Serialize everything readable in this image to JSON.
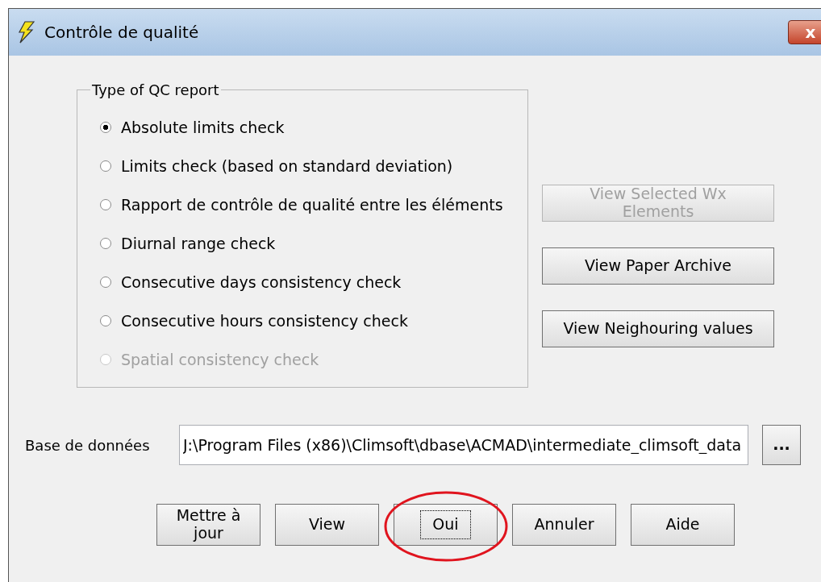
{
  "window": {
    "title": "Contrôle de qualité",
    "close": "x"
  },
  "report_type": {
    "legend": "Type of QC report",
    "options": [
      {
        "label": "Absolute limits check",
        "selected": true,
        "disabled": false
      },
      {
        "label": "Limits check (based on standard deviation)",
        "selected": false,
        "disabled": false
      },
      {
        "label": "Rapport de contrôle de qualité entre les éléments",
        "selected": false,
        "disabled": false
      },
      {
        "label": "Diurnal range check",
        "selected": false,
        "disabled": false
      },
      {
        "label": "Consecutive days consistency check",
        "selected": false,
        "disabled": false
      },
      {
        "label": "Consecutive hours consistency check",
        "selected": false,
        "disabled": false
      },
      {
        "label": "Spatial consistency check",
        "selected": false,
        "disabled": true
      }
    ]
  },
  "side_buttons": [
    {
      "label": "View Selected Wx Elements",
      "disabled": true
    },
    {
      "label": "View Paper Archive",
      "disabled": false
    },
    {
      "label": "View Neighouring values",
      "disabled": false
    }
  ],
  "database": {
    "label": "Base de données",
    "value": "J:\\Program Files (x86)\\Climsoft\\dbase\\ACMAD\\intermediate_climsoft_data",
    "browse": "..."
  },
  "buttons": [
    {
      "label": "Mettre à jour",
      "focused": false,
      "circled": false
    },
    {
      "label": "View",
      "focused": false,
      "circled": false
    },
    {
      "label": "Oui",
      "focused": true,
      "circled": true
    },
    {
      "label": "Annuler",
      "focused": false,
      "circled": false
    },
    {
      "label": "Aide",
      "focused": false,
      "circled": false
    }
  ]
}
